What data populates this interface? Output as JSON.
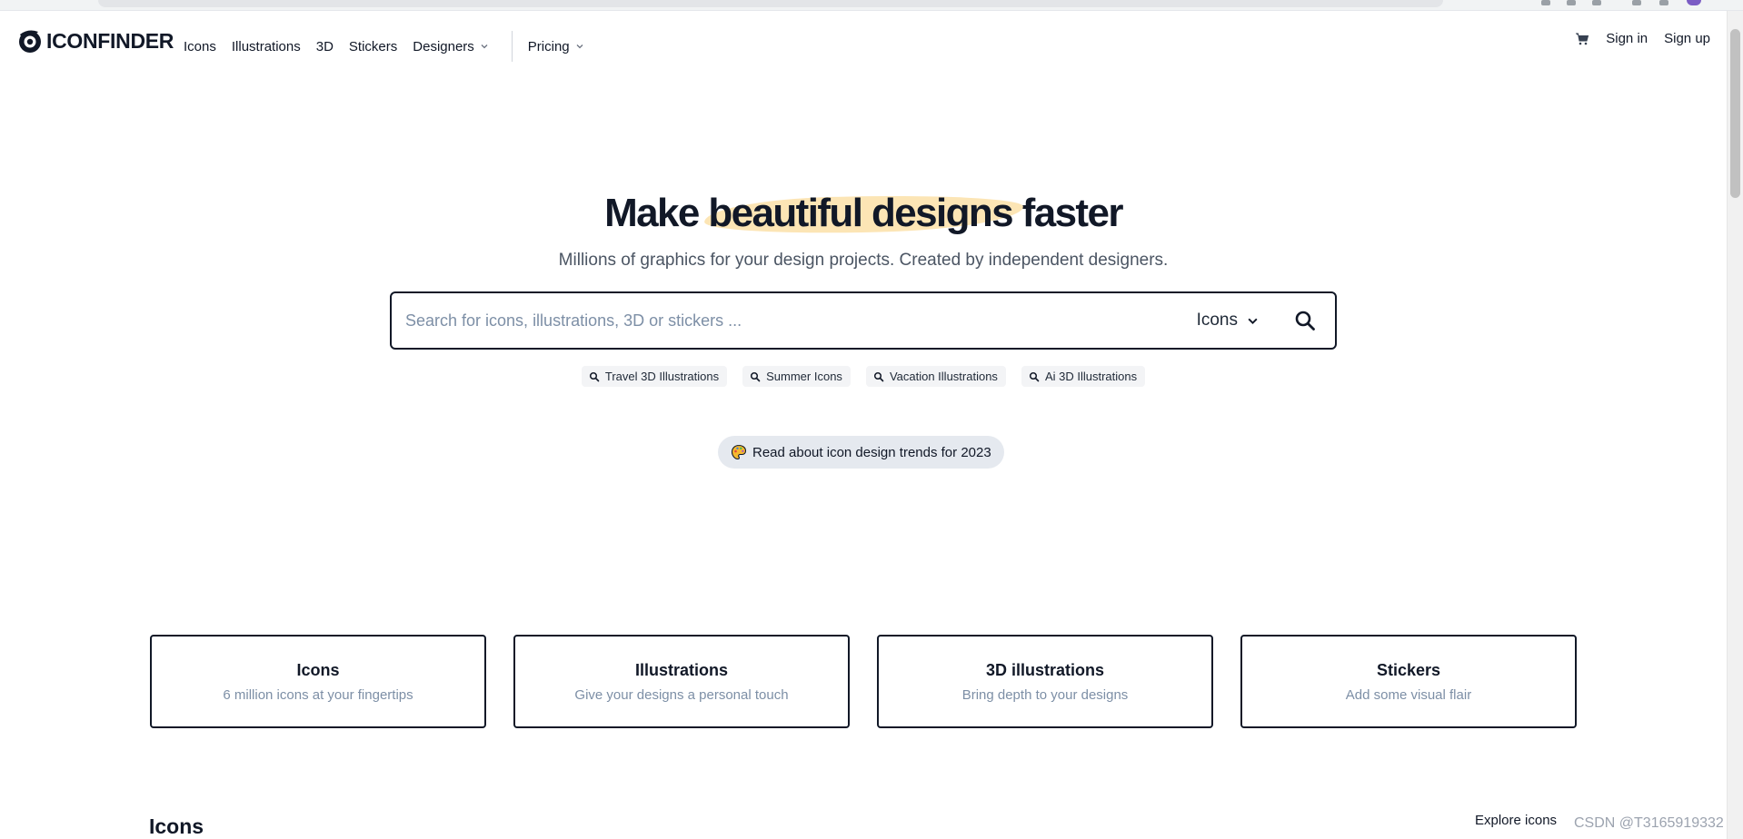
{
  "nav": {
    "logo_text": "ICONFINDER",
    "links": [
      "Icons",
      "Illustrations",
      "3D",
      "Stickers",
      "Designers"
    ],
    "pricing": "Pricing",
    "sign_in": "Sign in",
    "sign_up": "Sign up",
    "cart_icon": "cart-icon"
  },
  "hero": {
    "headline_pre": "Make ",
    "headline_highlight": "beautiful designs",
    "headline_post": " faster",
    "subtitle": "Millions of graphics for your design projects. Created by independent designers."
  },
  "search": {
    "placeholder": "Search for icons, illustrations, 3D or stickers ...",
    "value": "",
    "type_selected": "Icons"
  },
  "suggestions": [
    "Travel 3D Illustrations",
    "Summer Icons",
    "Vacation Illustrations",
    "Ai 3D Illustrations"
  ],
  "trend_link": "Read about icon design trends for 2023",
  "cards": [
    {
      "title": "Icons",
      "subtitle": "6 million icons at your fingertips"
    },
    {
      "title": "Illustrations",
      "subtitle": "Give your designs a personal touch"
    },
    {
      "title": "3D illustrations",
      "subtitle": "Bring depth to your designs"
    },
    {
      "title": "Stickers",
      "subtitle": "Add some visual flair"
    }
  ],
  "section": {
    "title": "Icons",
    "explore": "Explore icons"
  },
  "watermark": "CSDN @T3165919332",
  "colors": {
    "text": "#111827",
    "muted": "#7d8fa6",
    "highlight": "#fbe0a8",
    "chip_bg": "#f3f4f6",
    "pill_bg": "#e5e9ef"
  }
}
